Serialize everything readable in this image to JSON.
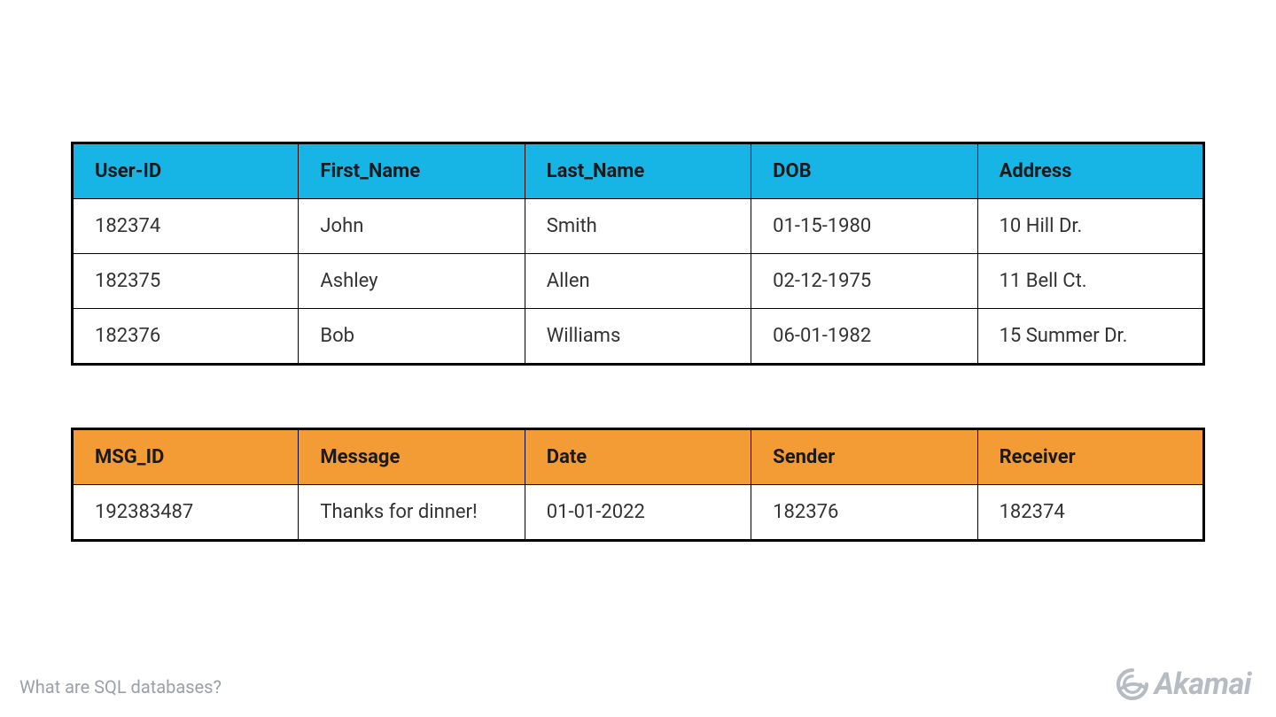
{
  "caption": "What are SQL databases?",
  "brand": "Akamai",
  "colors": {
    "users_header": "#17b5e6",
    "messages_header": "#f39b35"
  },
  "users_table": {
    "headers": [
      "User-ID",
      "First_Name",
      "Last_Name",
      "DOB",
      "Address"
    ],
    "rows": [
      [
        "182374",
        "John",
        "Smith",
        "01-15-1980",
        "10 Hill Dr."
      ],
      [
        "182375",
        "Ashley",
        "Allen",
        "02-12-1975",
        "11 Bell Ct."
      ],
      [
        "182376",
        "Bob",
        "Williams",
        "06-01-1982",
        "15 Summer Dr."
      ]
    ]
  },
  "messages_table": {
    "headers": [
      "MSG_ID",
      "Message",
      "Date",
      "Sender",
      "Receiver"
    ],
    "rows": [
      [
        "192383487",
        "Thanks for dinner!",
        "01-01-2022",
        "182376",
        "182374"
      ]
    ]
  }
}
